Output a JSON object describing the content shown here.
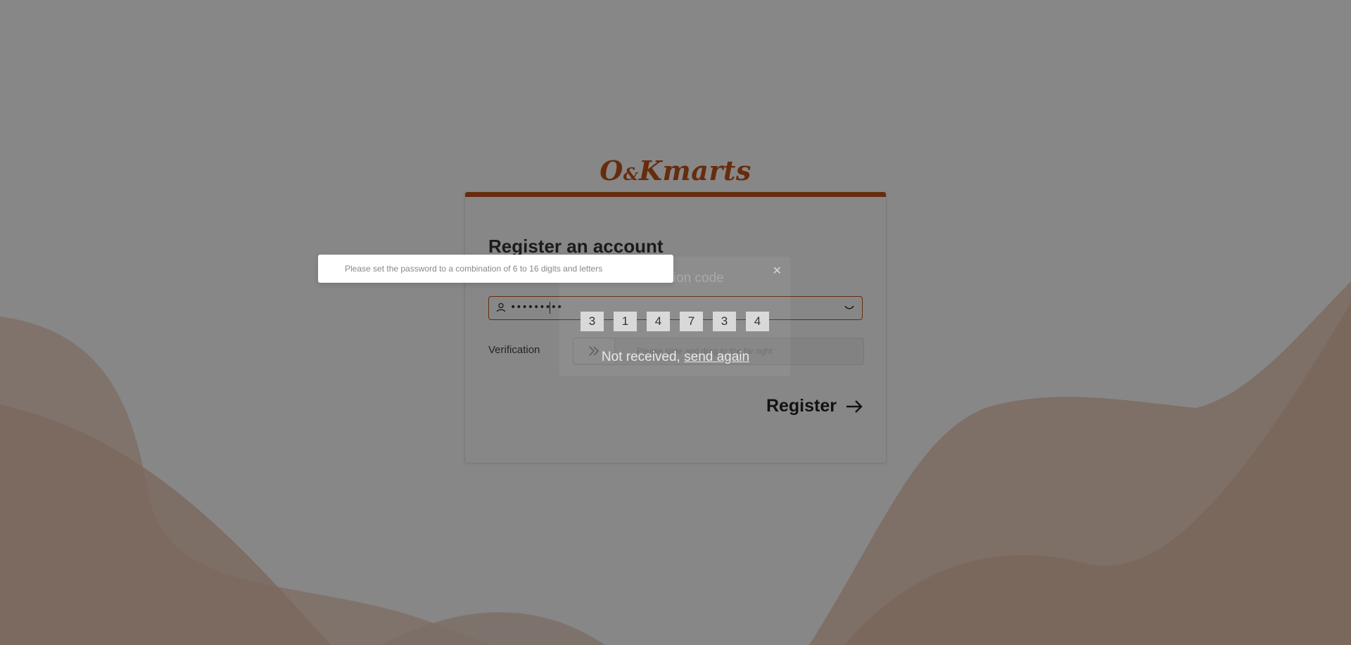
{
  "brand": {
    "logo_left": "O",
    "logo_amp": "&",
    "logo_right": "Kmarts",
    "color": "#c0531b"
  },
  "form": {
    "title": "Register an account",
    "password_value": "•••••••••",
    "verification_label": "Verification",
    "slider_hint": "Please slide and drag to the far right",
    "register_label": "Register"
  },
  "modal": {
    "title": "Verification code",
    "code_digits": [
      "3",
      "1",
      "4",
      "7",
      "3",
      "4"
    ],
    "not_received": "Not received,",
    "send_again": "send again"
  },
  "toast": {
    "message": "Please set the password to a combination of 6 to 16 digits and letters"
  },
  "colors": {
    "accent": "#c0531b",
    "overlay": "rgba(0,0,0,0.47)",
    "wave": "#e6c2ae"
  },
  "icons": [
    "user-icon",
    "eye-closed-icon",
    "double-chevron-right-icon",
    "arrow-right-icon",
    "close-icon"
  ]
}
